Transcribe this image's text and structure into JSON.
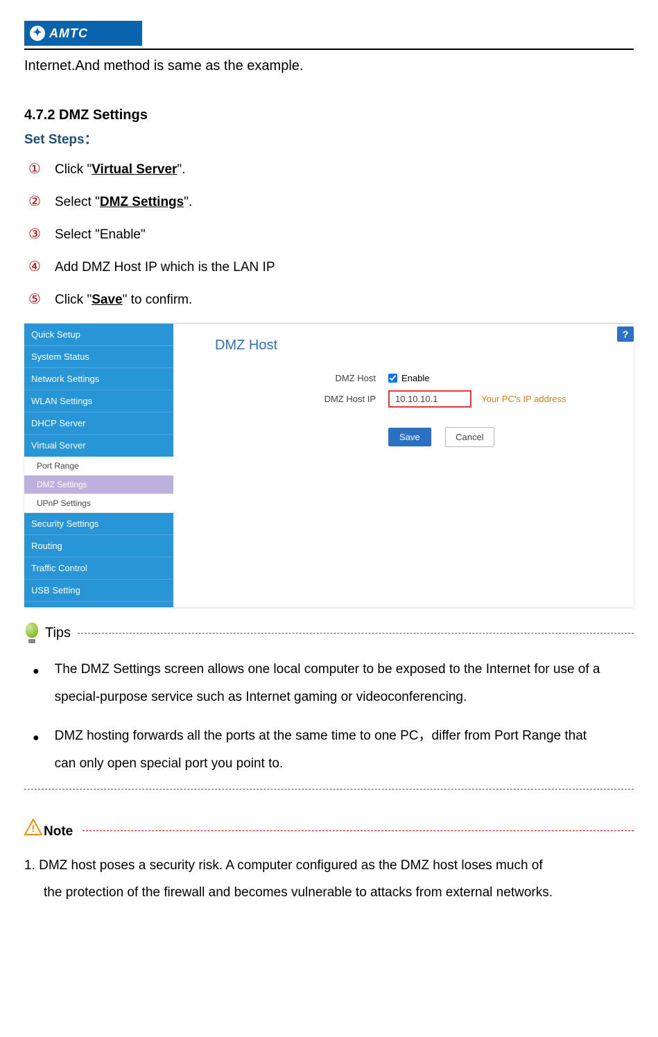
{
  "logo": {
    "text": "AMTC"
  },
  "intro_line": "Internet.And method is same as the example.",
  "section_heading": "4.7.2 DMZ Settings",
  "set_steps_label": "Set Steps：",
  "steps": {
    "1": {
      "num": "①",
      "pre": "Click \"",
      "link": "Virtual Server",
      "post": "\"."
    },
    "2": {
      "num": "②",
      "pre": "Select \"",
      "link": "DMZ Settings",
      "post": "\"."
    },
    "3": {
      "num": "③",
      "text": "Select \"Enable\""
    },
    "4": {
      "num": "④",
      "text": "Add DMZ Host IP which is the LAN IP"
    },
    "5": {
      "num": "⑤",
      "pre": "Click \"",
      "link": "Save",
      "post": "\" to confirm."
    }
  },
  "sidebar": {
    "items": {
      "0": "Quick Setup",
      "1": "System Status",
      "2": "Network Settings",
      "3": "WLAN Settings",
      "4": "DHCP Server",
      "5": "Virtual Server",
      "6": "Security Settings",
      "7": "Routing",
      "8": "Traffic Control",
      "9": "USB Setting"
    },
    "sub": {
      "0": "Port Range",
      "1": "DMZ Settings",
      "2": "UPnP Settings"
    }
  },
  "pane": {
    "title": "DMZ Host",
    "label_host": "DMZ Host",
    "enable_text": "Enable",
    "label_ip": "DMZ Host IP",
    "ip_value": "10.10.10.1",
    "annotation": "Your PC's IP address",
    "save": "Save",
    "cancel": "Cancel",
    "help": "?"
  },
  "tips": {
    "label": "Tips",
    "bullets": {
      "0": "The DMZ Settings screen allows one local computer to be exposed to the Internet for use of a special-purpose service such as Internet gaming or videoconferencing.",
      "1a": "DMZ hosting forwards all the ports at the same time to one PC，differ from Port Range that",
      "1b": "can only open special port you point to."
    }
  },
  "note": {
    "label": "Note",
    "line1": "1. DMZ host poses a security risk. A computer configured as the DMZ host loses much of",
    "line2": "the  protection  of  the  firewall  and  becomes  vulnerable  to  attacks  from  external networks."
  }
}
